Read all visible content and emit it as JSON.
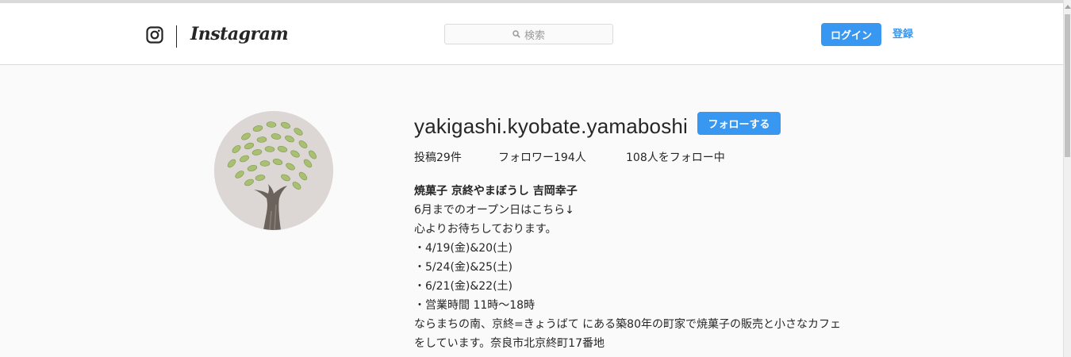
{
  "header": {
    "brand": "Instagram",
    "search_placeholder": "検索",
    "login_label": "ログイン",
    "signup_label": "登録",
    "accent_color": "#3897f0"
  },
  "profile": {
    "username": "yakigashi.kyobate.yamaboshi",
    "follow_label": "フォローする",
    "stats": {
      "posts": "投稿29件",
      "followers": "フォロワー194人",
      "following": "108人をフォロー中"
    },
    "bio": {
      "name": "焼菓子 京終やまぼうし 吉岡幸子",
      "lines": [
        "6月までのオープン日はこちら↓",
        "心よりお待ちしております。",
        "・4/19(金)&20(土)",
        "・5/24(金)&25(土)",
        "・6/21(金)&22(土)",
        "・営業時間 11時～18時",
        "ならまちの南、京終=きょうばて にある築80年の町家で焼菓子の販売と小さなカフェ",
        "をしています。奈良市北京終町17番地"
      ]
    }
  },
  "icons": [
    "instagram-camera-icon",
    "search-icon",
    "avatar-tree-image"
  ]
}
